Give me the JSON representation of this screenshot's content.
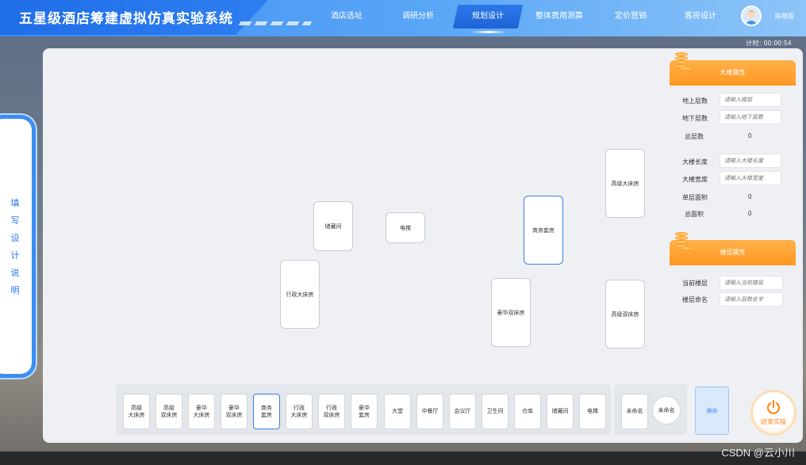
{
  "app": {
    "title": "五星级酒店筹建虚拟仿真实验系统"
  },
  "nav": {
    "items": [
      {
        "label": "酒店选址"
      },
      {
        "label": "调研分析"
      },
      {
        "label": "规划设计"
      },
      {
        "label": "整体费用测算"
      },
      {
        "label": "定价营销"
      },
      {
        "label": "客房设计"
      }
    ],
    "active_index": 2
  },
  "user": {
    "name": "陈晓雨"
  },
  "timer": {
    "label": "计时:",
    "value": "00:00:54"
  },
  "side_tab": {
    "label": "填写设计说明"
  },
  "canvas": {
    "rooms": [
      {
        "label": "储藏间"
      },
      {
        "label": "电梯"
      },
      {
        "label": "行政大床房"
      },
      {
        "label": "商务套房",
        "selected": true
      },
      {
        "label": "豪华双床房"
      },
      {
        "label": "高级大床房"
      },
      {
        "label": "高级双床房"
      }
    ]
  },
  "building_props": {
    "header": "大楼属性",
    "above_floors_label": "地上层数",
    "above_floors_placeholder": "请输入楼层",
    "below_floors_label": "地下层数",
    "below_floors_placeholder": "请输入地下层数",
    "total_floors_label": "总层数",
    "total_floors_value": "0",
    "length_label": "大楼长度",
    "length_placeholder": "请输入大楼长度",
    "width_label": "大楼宽度",
    "width_placeholder": "请输入大楼宽度",
    "floor_area_label": "单层面积",
    "floor_area_value": "0",
    "total_area_label": "总面积",
    "total_area_value": "0"
  },
  "floor_props": {
    "header": "楼层属性",
    "current_floor_label": "当前楼层",
    "current_floor_placeholder": "请输入当前楼层",
    "floor_name_label": "楼层命名",
    "floor_name_placeholder": "请输入层数名字"
  },
  "toolbar": {
    "tools": [
      {
        "label": "高级\n大床房"
      },
      {
        "label": "高级\n双床房"
      },
      {
        "label": "豪华\n大床房"
      },
      {
        "label": "豪华\n双床房"
      },
      {
        "label": "商务\n套房",
        "active": true
      },
      {
        "label": "行政\n大床房"
      },
      {
        "label": "行政\n双床房"
      },
      {
        "label": "豪华\n套房"
      },
      {
        "label": "大堂"
      },
      {
        "label": "中餐厅"
      },
      {
        "label": "会议厅"
      },
      {
        "label": "卫生间"
      },
      {
        "label": "仓库"
      },
      {
        "label": "储藏间"
      },
      {
        "label": "电梯"
      }
    ],
    "extra": [
      {
        "label": "未命名"
      },
      {
        "label": "未命名"
      }
    ],
    "save_label": "保存",
    "end_label": "结束实操"
  },
  "watermark": "CSDN @云小川",
  "colors": {
    "primary": "#3a7de8",
    "accent": "#ff9722",
    "panel": "#eef0f3"
  }
}
